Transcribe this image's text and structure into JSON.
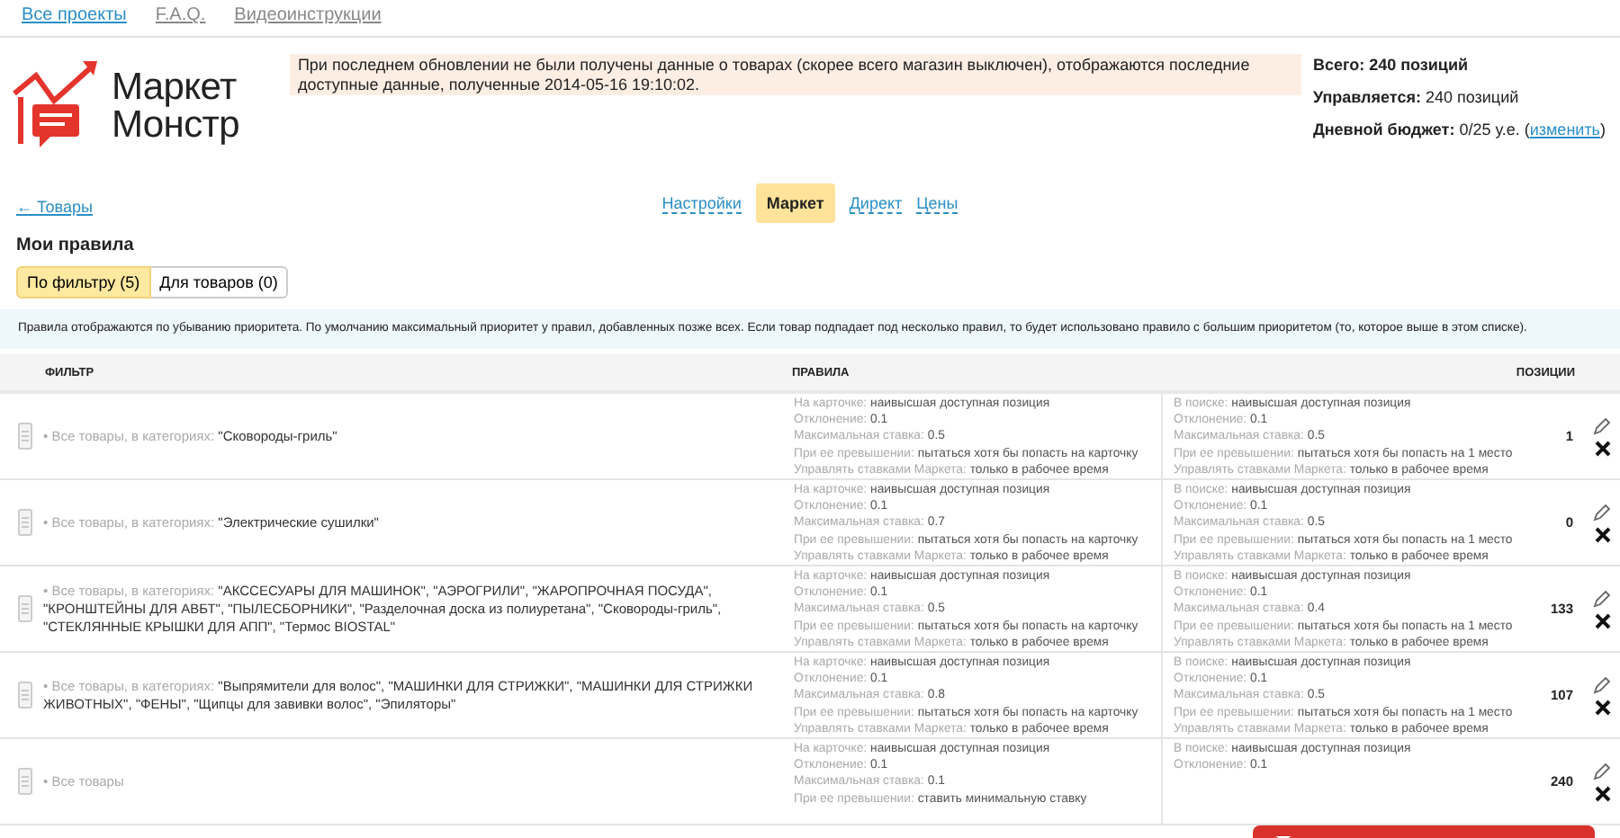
{
  "top_nav": [
    {
      "label": "Все проекты",
      "selected": true
    },
    {
      "label": "F.A.Q.",
      "selected": false
    },
    {
      "label": "Видеоинструкции",
      "selected": false
    }
  ],
  "logo": {
    "line1": "Маркет",
    "line2": "Монстр"
  },
  "notice": "При последнем обновлении не были получены данные о товарах (скорее всего магазин выключен), отображаются последние доступные данные, полученные 2014-05-16 19:10:02.",
  "stats": [
    {
      "label": "Всего: 240 позиций"
    },
    {
      "label": "Управляется:",
      "value": "240 позиций"
    },
    {
      "label": "Дневной бюджет:",
      "value": "0/25 у.е. (",
      "link": "изменить",
      "after": ")"
    }
  ],
  "back_link": "← Товары",
  "tabs": [
    {
      "label": "Настройки",
      "selected": false
    },
    {
      "label": "Маркет",
      "selected": true
    },
    {
      "label": "Директ",
      "selected": false
    },
    {
      "label": "Цены",
      "selected": false
    }
  ],
  "section_title": "Мои правила",
  "toggle": [
    {
      "label": "По фильтру (5)",
      "selected": true
    },
    {
      "label": "Для товаров (0)",
      "selected": false
    }
  ],
  "info": "Правила отображаются по убыванию приоритета. По умолчанию максимальный приоритет у правил, добавленных позже всех. Если товар подпадает под несколько правил, то будет использовано правило с большим приоритетом (то, которое выше в этом списке).",
  "table": {
    "columns": [
      "ФИЛЬТР",
      "ПРАВИЛА",
      "ПОЗИЦИИ"
    ],
    "rows": [
      {
        "prefix": "• Все товары, в категориях:",
        "categories": "\"Сковороды-гриль\"",
        "positions": "1",
        "card": [
          {
            "label": "На карточке:",
            "value": "наивысшая доступная позиция"
          },
          {
            "label": "Отклонение:",
            "value": "0.1"
          },
          {
            "label": "Максимальная ставка:",
            "value": "0.5"
          },
          {
            "label": "При ее превышении:",
            "value": "пытаться хотя бы попасть на карточку"
          },
          {
            "label": "Управлять ставками Маркета:",
            "value": "только в рабочее время"
          }
        ],
        "search": [
          {
            "label": "В поиске:",
            "value": "наивысшая доступная позиция"
          },
          {
            "label": "Отклонение:",
            "value": "0.1"
          },
          {
            "label": "Максимальная ставка:",
            "value": "0.5"
          },
          {
            "label": "При ее превышении:",
            "value": "пытаться хотя бы попасть на 1 место"
          },
          {
            "label": "Управлять ставками Маркета:",
            "value": "только в рабочее время"
          }
        ]
      },
      {
        "prefix": "• Все товары, в категориях:",
        "categories": "\"Электрические сушилки\"",
        "positions": "0",
        "card": [
          {
            "label": "На карточке:",
            "value": "наивысшая доступная позиция"
          },
          {
            "label": "Отклонение:",
            "value": "0.1"
          },
          {
            "label": "Максимальная ставка:",
            "value": "0.7"
          },
          {
            "label": "При ее превышении:",
            "value": "пытаться хотя бы попасть на карточку"
          },
          {
            "label": "Управлять ставками Маркета:",
            "value": "только в рабочее время"
          }
        ],
        "search": [
          {
            "label": "В поиске:",
            "value": "наивысшая доступная позиция"
          },
          {
            "label": "Отклонение:",
            "value": "0.1"
          },
          {
            "label": "Максимальная ставка:",
            "value": "0.5"
          },
          {
            "label": "При ее превышении:",
            "value": "пытаться хотя бы попасть на 1 место"
          },
          {
            "label": "Управлять ставками Маркета:",
            "value": "только в рабочее время"
          }
        ]
      },
      {
        "prefix": "• Все товары, в категориях:",
        "categories": "\"АКССЕСУАРЫ ДЛЯ МАШИНОК\", \"АЭРОГРИЛИ\", \"ЖАРОПРОЧНАЯ ПОСУДА\", \"КРОНШТЕЙНЫ ДЛЯ АВБТ\", \"ПЫЛЕСБОРНИКИ\", \"Разделочная доска из полиуретана\", \"Сковороды-гриль\", \"СТЕКЛЯННЫЕ КРЫШКИ ДЛЯ АПП\", \"Термос BIOSTAL\"",
        "positions": "133",
        "card": [
          {
            "label": "На карточке:",
            "value": "наивысшая доступная позиция"
          },
          {
            "label": "Отклонение:",
            "value": "0.1"
          },
          {
            "label": "Максимальная ставка:",
            "value": "0.5"
          },
          {
            "label": "При ее превышении:",
            "value": "пытаться хотя бы попасть на карточку"
          },
          {
            "label": "Управлять ставками Маркета:",
            "value": "только в рабочее время"
          }
        ],
        "search": [
          {
            "label": "В поиске:",
            "value": "наивысшая доступная позиция"
          },
          {
            "label": "Отклонение:",
            "value": "0.1"
          },
          {
            "label": "Максимальная ставка:",
            "value": "0.4"
          },
          {
            "label": "При ее превышении:",
            "value": "пытаться хотя бы попасть на 1 место"
          },
          {
            "label": "Управлять ставками Маркета:",
            "value": "только в рабочее время"
          }
        ]
      },
      {
        "prefix": "• Все товары, в категориях:",
        "categories": "\"Выпрямители для волос\", \"МАШИНКИ ДЛЯ СТРИЖКИ\", \"МАШИНКИ ДЛЯ СТРИЖКИ ЖИВОТНЫХ\", \"ФЕНЫ\", \"Щипцы для завивки волос\", \"Эпиляторы\"",
        "positions": "107",
        "card": [
          {
            "label": "На карточке:",
            "value": "наивысшая доступная позиция"
          },
          {
            "label": "Отклонение:",
            "value": "0.1"
          },
          {
            "label": "Максимальная ставка:",
            "value": "0.8"
          },
          {
            "label": "При ее превышении:",
            "value": "пытаться хотя бы попасть на карточку"
          },
          {
            "label": "Управлять ставками Маркета:",
            "value": "только в рабочее время"
          }
        ],
        "search": [
          {
            "label": "В поиске:",
            "value": "наивысшая доступная позиция"
          },
          {
            "label": "Отклонение:",
            "value": "0.1"
          },
          {
            "label": "Максимальная ставка:",
            "value": "0.5"
          },
          {
            "label": "При ее превышении:",
            "value": "пытаться хотя бы попасть на 1 место"
          },
          {
            "label": "Управлять ставками Маркета:",
            "value": "только в рабочее время"
          }
        ]
      },
      {
        "prefix": "• Все товары",
        "positions": "240",
        "card": [
          {
            "label": "На карточке:",
            "value": "наивысшая доступная позиция"
          },
          {
            "label": "Отклонение:",
            "value": "0.1"
          },
          {
            "label": "Максимальная ставка:",
            "value": "0.1"
          },
          {
            "label": "При ее превышении:",
            "value": "ставить минимальную ставку"
          }
        ],
        "search": [
          {
            "label": "В поиске:",
            "value": "наивысшая доступная позиция"
          },
          {
            "label": "Отклонение:",
            "value": "0.1"
          }
        ]
      }
    ]
  }
}
